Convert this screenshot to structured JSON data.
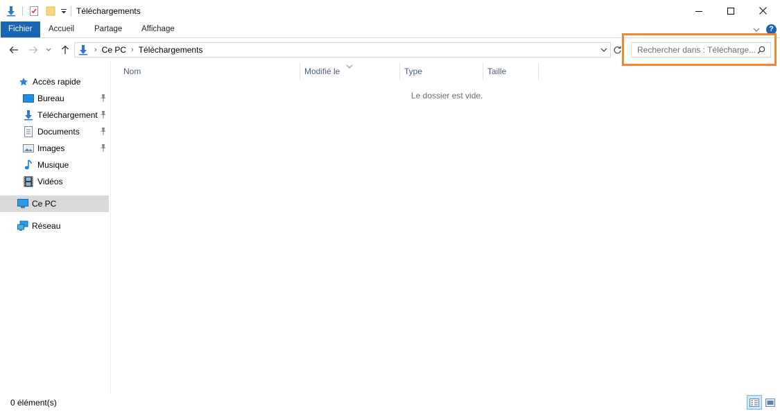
{
  "window": {
    "title": "Téléchargements"
  },
  "quick_access_toolbar": {
    "icons": [
      "download-arrow-icon",
      "properties-checklist-icon",
      "new-folder-icon",
      "customize-dropdown-icon"
    ]
  },
  "ribbon": {
    "tabs": [
      {
        "label": "Fichier",
        "active": true
      },
      {
        "label": "Accueil"
      },
      {
        "label": "Partage"
      },
      {
        "label": "Affichage"
      }
    ],
    "help_label": "?"
  },
  "address": {
    "crumbs": [
      "Ce PC",
      "Téléchargements"
    ],
    "separator": "›"
  },
  "search": {
    "placeholder": "Rechercher dans : Télécharge..."
  },
  "navigation": {
    "quick_access": {
      "label": "Accès rapide"
    },
    "items": [
      {
        "label": "Bureau",
        "icon": "desktop-icon",
        "pinned": true
      },
      {
        "label": "Téléchargements",
        "icon": "download-arrow-icon",
        "pinned": true
      },
      {
        "label": "Documents",
        "icon": "document-icon",
        "pinned": true
      },
      {
        "label": "Images",
        "icon": "image-icon",
        "pinned": true
      },
      {
        "label": "Musique",
        "icon": "music-note-icon",
        "pinned": false
      },
      {
        "label": "Vidéos",
        "icon": "film-icon",
        "pinned": false
      }
    ],
    "this_pc": {
      "label": "Ce PC",
      "selected": true
    },
    "network": {
      "label": "Réseau"
    }
  },
  "columns": [
    "Nom",
    "Modifié le",
    "Type",
    "Taille"
  ],
  "content": {
    "empty_message": "Le dossier est vide."
  },
  "status": {
    "item_count": "0 élément(s)"
  },
  "colors": {
    "accent": "#1a64b4",
    "highlight": "#f0882f",
    "selected_bg": "#d9d9d9"
  }
}
